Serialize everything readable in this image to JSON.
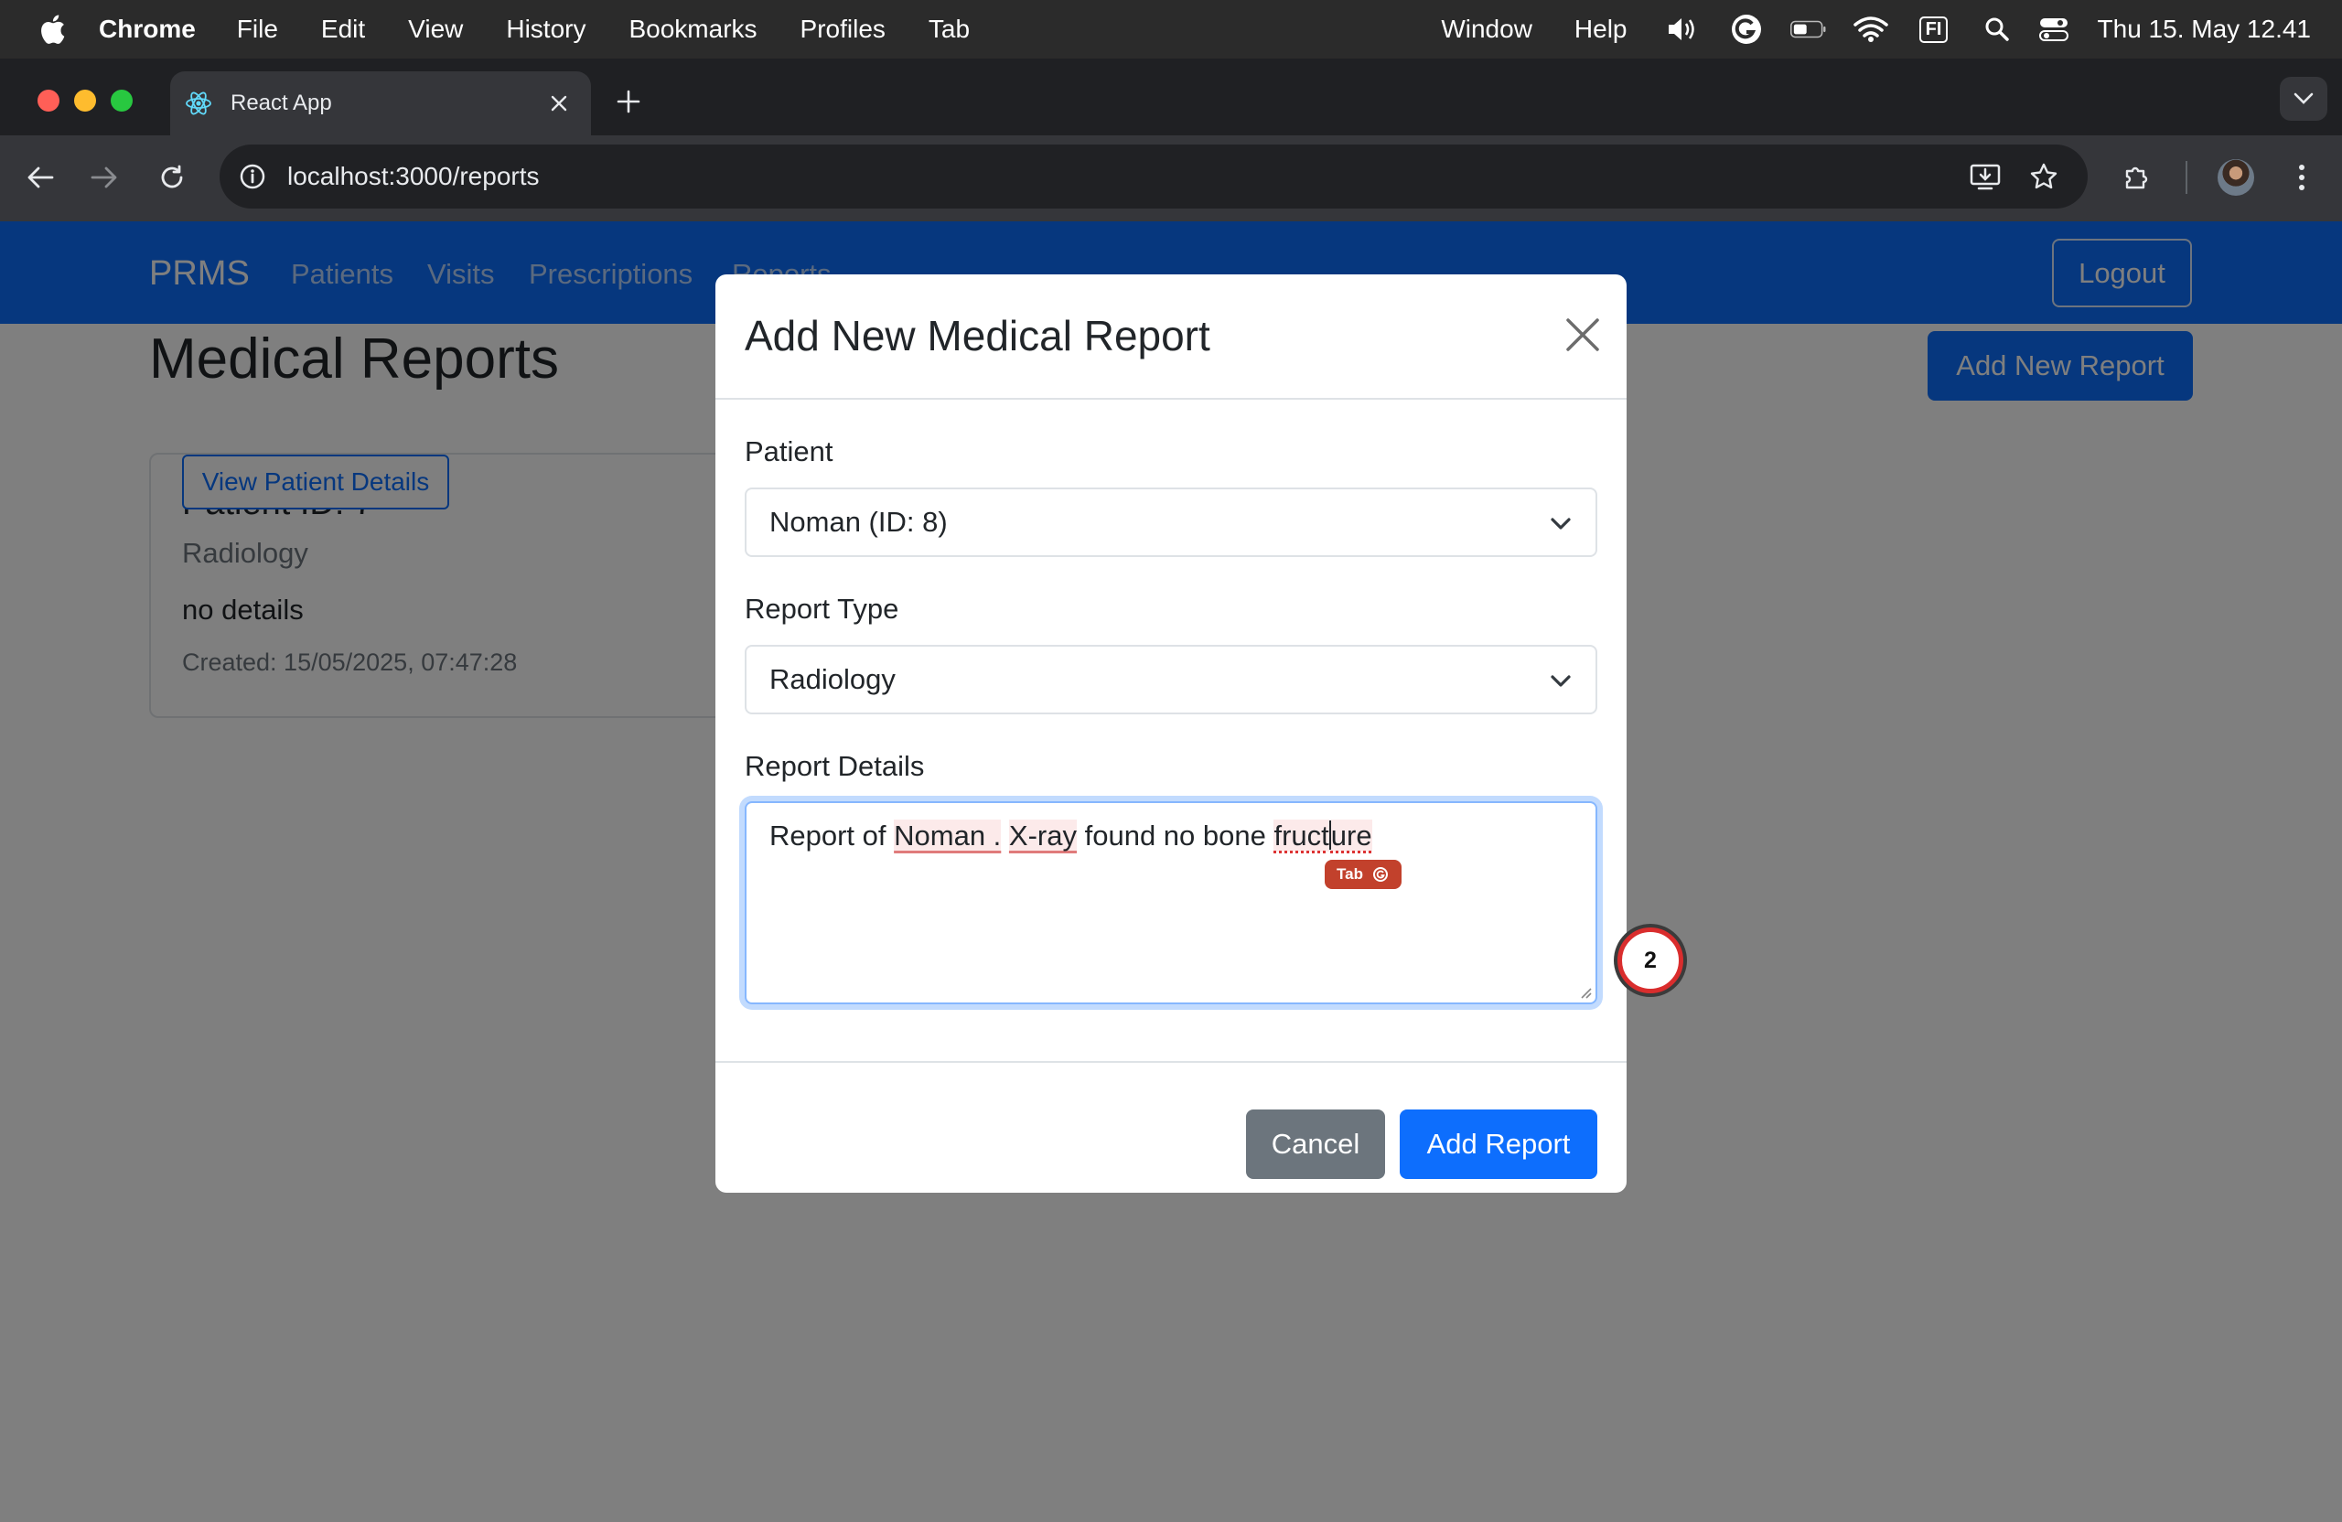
{
  "menubar": {
    "app": "Chrome",
    "items": [
      "File",
      "Edit",
      "View",
      "History",
      "Bookmarks",
      "Profiles",
      "Tab"
    ],
    "right_items": [
      "Window",
      "Help"
    ],
    "input_source": "FI",
    "clock": "Thu 15. May  12.41"
  },
  "browser": {
    "tab_title": "React App",
    "url": "localhost:3000/reports"
  },
  "app": {
    "brand": "PRMS",
    "nav": [
      "Patients",
      "Visits",
      "Prescriptions",
      "Reports"
    ],
    "logout_label": "Logout",
    "page_title": "Medical Reports",
    "add_new_label": "Add New Report",
    "card": {
      "title": "Patient ID: 7",
      "subtitle": "Radiology",
      "text": "no details",
      "created": "Created: 15/05/2025, 07:47:28",
      "button": "View Patient Details"
    }
  },
  "modal": {
    "title": "Add New Medical Report",
    "patient_label": "Patient",
    "patient_value": "Noman (ID: 8)",
    "type_label": "Report Type",
    "type_value": "Radiology",
    "details_label": "Report Details",
    "details_parts": [
      "Report of ",
      "Noman .",
      " ",
      "X-ray",
      " found no bone ",
      "fruct",
      "ure"
    ],
    "tab_hint": "Tab",
    "cancel_label": "Cancel",
    "submit_label": "Add Report"
  },
  "extension_badge": {
    "count": "2"
  },
  "colors": {
    "primary": "#0d6efd",
    "secondary": "#6c757d",
    "backdrop": "#7f7f7f",
    "grammar_red": "#d92d2d"
  }
}
